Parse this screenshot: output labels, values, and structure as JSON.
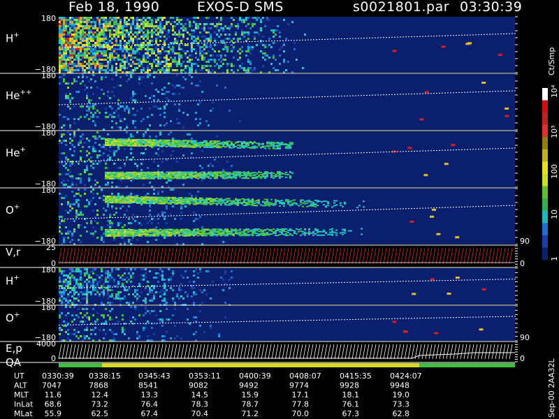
{
  "header": {
    "date": "Feb 18, 1990",
    "instrument": "EXOS-D SMS",
    "file": "s0021801.par",
    "time": "03:30:39"
  },
  "colorbar": {
    "unit": "Ct/Smp",
    "tick_labels": [
      "10⁴",
      "10³",
      "100",
      "10",
      "1"
    ]
  },
  "chart_data": {
    "type": "heatmap",
    "title": "Feb 18, 1990   EXOS-D SMS",
    "x_time_ticks": [
      "0330:39",
      "0338:15",
      "0345:43",
      "0353:11",
      "0400:39",
      "0408:07",
      "0415:35",
      "0424:07"
    ],
    "colorbar_scale": "log",
    "colorbar_range": [
      1,
      10000
    ],
    "panels": [
      {
        "label": "H",
        "sup": "+",
        "ytick_top": "180",
        "ytick_bottom": "−180"
      },
      {
        "label": "He",
        "sup": "++",
        "ytick_top": "180",
        "ytick_bottom": "−180"
      },
      {
        "label": "He",
        "sup": "+",
        "ytick_top": "180",
        "ytick_bottom": "−180"
      },
      {
        "label": "O",
        "sup": "+",
        "ytick_top": "180",
        "ytick_bottom": "−180",
        "right_tick": "90"
      },
      {
        "label": "V,r",
        "sup": "",
        "ytick_top": "25",
        "ytick_bottom": "0",
        "right_tick": "0"
      },
      {
        "label": "H",
        "sup": "+",
        "ytick_top": "180",
        "ytick_bottom": "−180"
      },
      {
        "label": "O",
        "sup": "+",
        "ytick_top": "180",
        "ytick_bottom": "−180",
        "right_tick": "90"
      },
      {
        "label": "E,p",
        "sup": "",
        "ytick_top": "4000",
        "ytick_bottom": "0",
        "right_tick": "0"
      }
    ],
    "qa_label": "QA",
    "orbit_table": {
      "rows": [
        {
          "name": "UT",
          "values": [
            "0330:39",
            "0338:15",
            "0345:43",
            "0353:11",
            "0400:39",
            "0408:07",
            "0415:35",
            "0424:07"
          ]
        },
        {
          "name": "ALT",
          "values": [
            "7047",
            "7868",
            "8541",
            "9082",
            "9492",
            "9774",
            "9928",
            "9948"
          ]
        },
        {
          "name": "MLT",
          "values": [
            "11.6",
            "12.4",
            "13.3",
            "14.5",
            "15.9",
            "17.1",
            "18.1",
            "19.0"
          ]
        },
        {
          "name": "InLat",
          "values": [
            "68.6",
            "73.2",
            "76.4",
            "78.3",
            "78.7",
            "77.8",
            "76.1",
            "73.3"
          ]
        },
        {
          "name": "MLat",
          "values": [
            "55.9",
            "62.5",
            "67.4",
            "70.4",
            "71.2",
            "70.0",
            "67.3",
            "62.8"
          ]
        }
      ]
    },
    "footer_note": "Sep-00 2AA32L"
  }
}
